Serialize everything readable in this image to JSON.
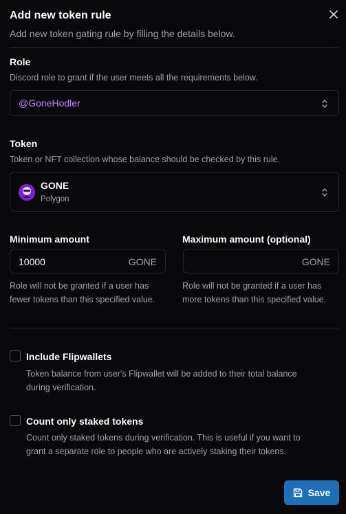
{
  "dialog": {
    "title": "Add new token rule",
    "subtitle": "Add new token gating rule by filling the details below."
  },
  "role": {
    "label": "Role",
    "help": "Discord role to grant if the user meets all the requirements below.",
    "value": "@GoneHodler"
  },
  "token": {
    "label": "Token",
    "help": "Token or NFT collection whose balance should be checked by this rule.",
    "name": "GONE",
    "network": "Polygon"
  },
  "minimum": {
    "label": "Minimum amount",
    "value": "10000",
    "suffix": "GONE",
    "help_line1": "Role will not be granted if a user has",
    "help_line2": "fewer tokens than this specified value."
  },
  "maximum": {
    "label": "Maximum amount (optional)",
    "value": "",
    "suffix": "GONE",
    "help_line1": "Role will not be granted if a user has",
    "help_line2": "more tokens than this specified value."
  },
  "flipwallets": {
    "label": "Include Flipwallets",
    "checked": false,
    "help_line1": "Token balance from user's Flipwallet will be added to their total balance",
    "help_line2": "during verification."
  },
  "staked": {
    "label": "Count only staked tokens",
    "checked": false,
    "help_line1": "Count only staked tokens during verification. This is useful if you want to",
    "help_line2": "grant a separate role to people who are actively staking their tokens."
  },
  "actions": {
    "save_label": "Save"
  },
  "colors": {
    "background": "#09090b",
    "accent": "#1d6fb8",
    "role_mention": "#c084fc",
    "muted_text": "#a1a1aa",
    "border": "#27272a"
  },
  "icons": {
    "close": "close-icon",
    "select_toggle": "chevron-up-down-icon",
    "token": "gone-token-icon",
    "save": "floppy-disk-icon"
  }
}
